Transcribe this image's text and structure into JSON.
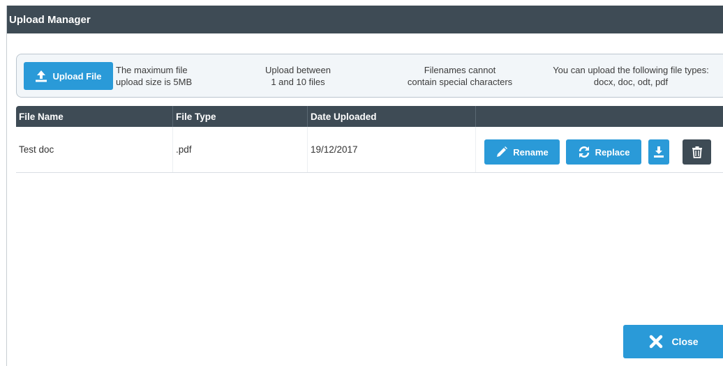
{
  "dialog": {
    "title": "Upload Manager"
  },
  "upload": {
    "button_label": "Upload File",
    "icon": "upload-icon",
    "info": [
      {
        "line1": "The maximum file",
        "line2": "upload size is 5MB"
      },
      {
        "line1": "Upload between",
        "line2": "1 and 10 files"
      },
      {
        "line1": "Filenames cannot",
        "line2": "contain special characters"
      },
      {
        "line1": "You can upload the following file types:",
        "line2": "docx, doc, odt, pdf"
      }
    ]
  },
  "table": {
    "columns": [
      "File Name",
      "File Type",
      "Date Uploaded",
      ""
    ],
    "rows": [
      {
        "name": "Test doc",
        "type": ".pdf",
        "date": "19/12/2017"
      }
    ],
    "actions": {
      "rename_label": "Rename",
      "replace_label": "Replace",
      "rename_icon": "pencil-icon",
      "replace_icon": "refresh-icon",
      "download_icon": "download-icon",
      "delete_icon": "trash-icon"
    }
  },
  "footer": {
    "close_label": "Close",
    "close_icon": "close-x-icon"
  },
  "colors": {
    "header": "#3e4b55",
    "accent": "#2a9ad8",
    "info_bg": "#f2f6f9"
  }
}
